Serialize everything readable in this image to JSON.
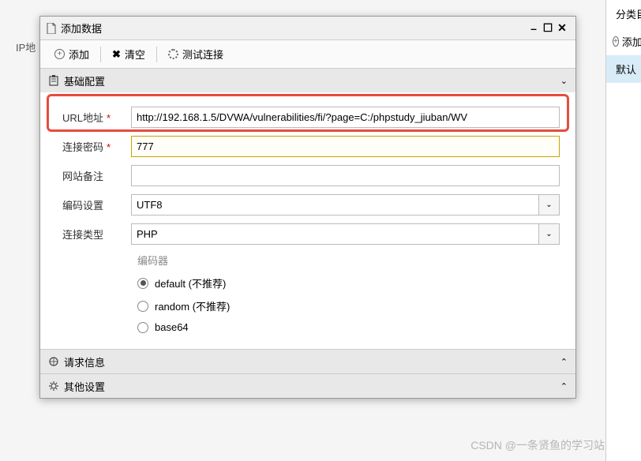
{
  "background": {
    "ip_label": "IP地"
  },
  "sidebar": {
    "categories_label": "分类目",
    "add_label": "添加",
    "default_label": "默认"
  },
  "modal": {
    "title": "添加数据"
  },
  "toolbar": {
    "add_label": "添加",
    "clear_label": "清空",
    "test_label": "测试连接"
  },
  "panels": {
    "basic": {
      "title": "基础配置",
      "expanded": true
    },
    "request": {
      "title": "请求信息",
      "expanded": false
    },
    "other": {
      "title": "其他设置",
      "expanded": false
    }
  },
  "form": {
    "url": {
      "label": "URL地址",
      "required": true,
      "value": "http://192.168.1.5/DVWA/vulnerabilities/fi/?page=C:/phpstudy_jiuban/WV"
    },
    "password": {
      "label": "连接密码",
      "required": true,
      "value": "777"
    },
    "remark": {
      "label": "网站备注",
      "required": false,
      "value": ""
    },
    "encoding": {
      "label": "编码设置",
      "value": "UTF8"
    },
    "type": {
      "label": "连接类型",
      "value": "PHP"
    },
    "encoder": {
      "title": "编码器",
      "options": [
        {
          "label": "default (不推荐)",
          "checked": true
        },
        {
          "label": "random (不推荐)",
          "checked": false
        },
        {
          "label": "base64",
          "checked": false
        }
      ]
    }
  },
  "watermark": "CSDN @一条贤鱼的学习站"
}
